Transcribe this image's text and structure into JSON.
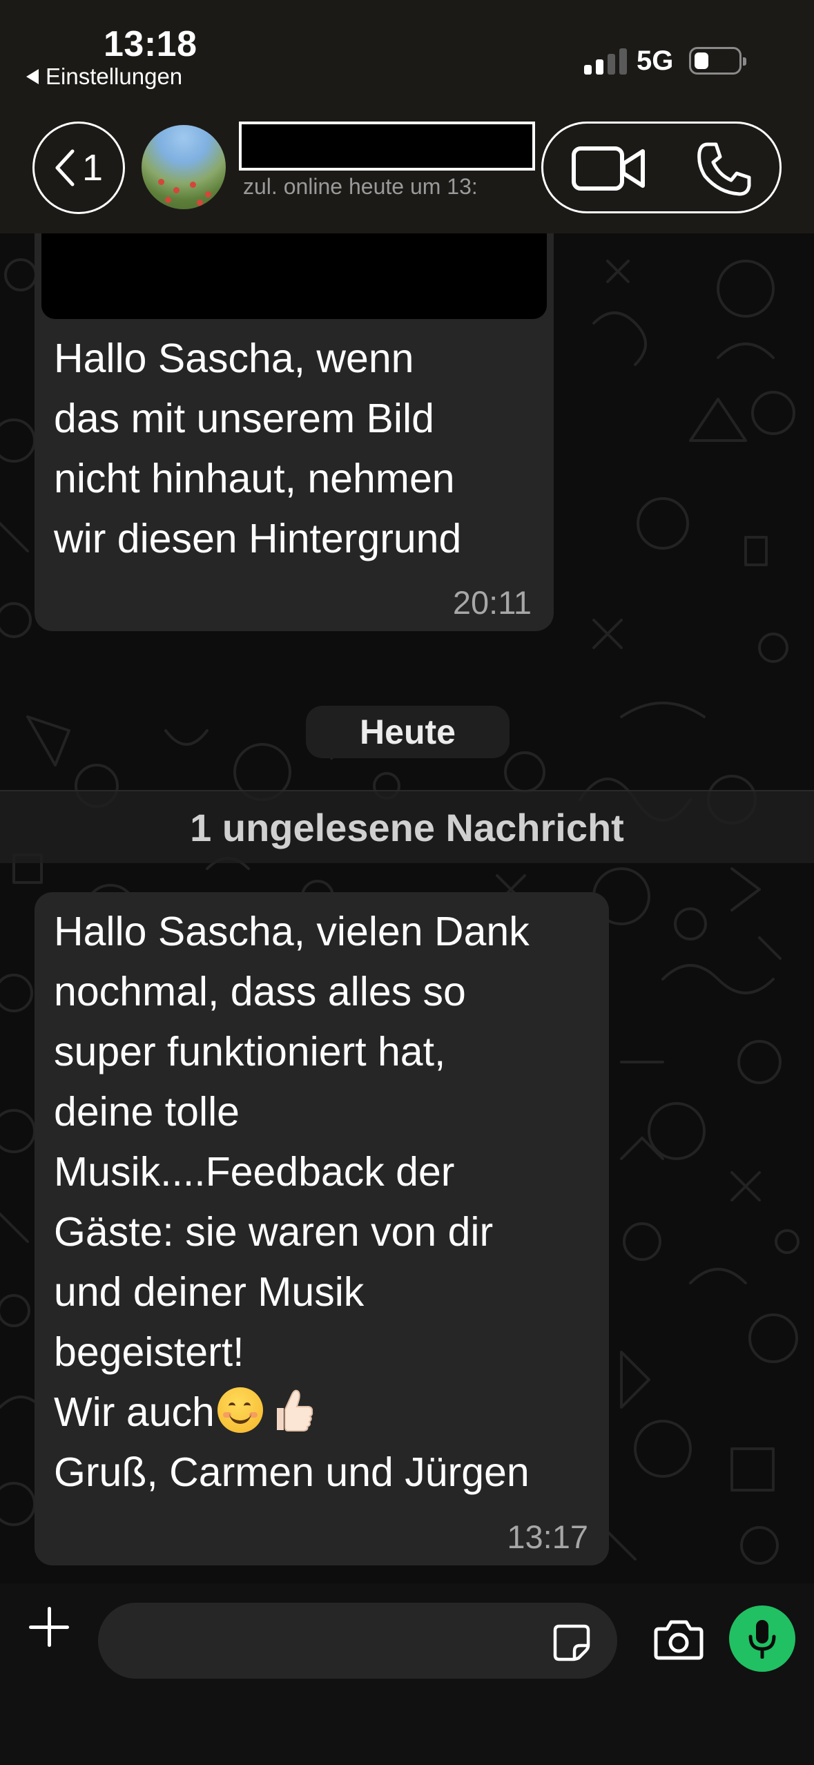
{
  "status_bar": {
    "time": "13:18",
    "back_app_label": "Einstellungen",
    "network": "5G",
    "signal_bars": 4,
    "signal_bars_active": 2,
    "battery_level_fraction": 0.2
  },
  "header": {
    "back_count": "1",
    "contact_name_redacted": "",
    "last_seen": "zul. online heute um 13:",
    "icons": {
      "back": "chevron-left-icon",
      "video_call": "video-camera-icon",
      "voice_call": "phone-icon"
    }
  },
  "messages": [
    {
      "direction": "incoming",
      "has_media": true,
      "text": "Hallo Sascha, wenn\ndas mit unserem Bild\nnicht hinhaut, nehmen\nwir diesen Hintergrund",
      "time": "20:11"
    },
    {
      "direction": "incoming",
      "has_media": false,
      "text_before_emoji": "Hallo Sascha, vielen Dank\nnochmal, dass alles so\nsuper funktioniert hat,\ndeine tolle\nMusik....Feedback der\nGäste: sie waren von dir\nund deiner Musik\nbegeistert!\nWir auch",
      "emojis": [
        "smiling-face-icon",
        "thumbs-up-icon"
      ],
      "text_after_emoji": "\nGruß, Carmen und Jürgen",
      "time": "13:17"
    }
  ],
  "day_separator": "Heute",
  "unread_banner": "1 ungelesene Nachricht",
  "composer": {
    "placeholder": "",
    "icons": {
      "attach": "plus-icon",
      "sticker": "sticker-icon",
      "camera": "camera-icon",
      "microphone": "microphone-icon"
    }
  },
  "colors": {
    "header_bg": "#1c1a17",
    "bubble_bg": "#262626",
    "mic_button": "#21c063",
    "timestamp": "#a7a7a7"
  }
}
